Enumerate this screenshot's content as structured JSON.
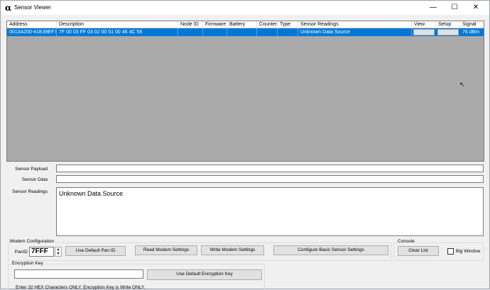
{
  "window": {
    "title": "Sensor Viewer",
    "app_icon": "alpha-icon",
    "minimize": "—",
    "maximize": "☐",
    "close": "✕"
  },
  "grid": {
    "columns": [
      "Address",
      "Description",
      "Node ID",
      "Firmware",
      "Battery",
      "Counter",
      "Type",
      "Sensor Readings",
      "View",
      "Setup",
      "Signal"
    ],
    "rows": [
      {
        "address": "0013A200-41E39EF7",
        "description": "7F 00 03 FF 03 02 00 51 00 46 4C 59",
        "node_id": "",
        "firmware": "",
        "battery": "",
        "counter": "",
        "type": "",
        "sensor_readings": "Unknown Data Source",
        "signal": "76 dBm"
      }
    ],
    "selected_row": 0
  },
  "fields": {
    "sensor_payload_label": "Sensor Payload",
    "sensor_payload_value": "",
    "sensor_data_label": "Sensor Data",
    "sensor_data_value": "",
    "sensor_readings_label": "Sensor Readings",
    "sensor_readings_value": "Unknown Data Source"
  },
  "modem": {
    "group_label": "Modem Configuration",
    "panid_label": "PanID",
    "panid_value": "7FFF",
    "default_pan_button": "Use Default Pan ID",
    "read_button": "Read Modem Settings",
    "write_button": "Write Modem Settings",
    "basic_sensor_button": "Configure Basic Sensor Settings"
  },
  "encryption": {
    "group_label": "Encryption Key",
    "key_value": "",
    "default_key_button": "Use Default Encryption Key",
    "hint": "Enter 32 HEX Characters ONLY.  Encryption Key is Write ONLY."
  },
  "console": {
    "group_label": "Console",
    "clear_button": "Clear List",
    "big_window_label": "Big Window",
    "big_window_checked": false
  },
  "colors": {
    "selection": "#0078d7",
    "grid_bg": "#aaaaaa"
  }
}
